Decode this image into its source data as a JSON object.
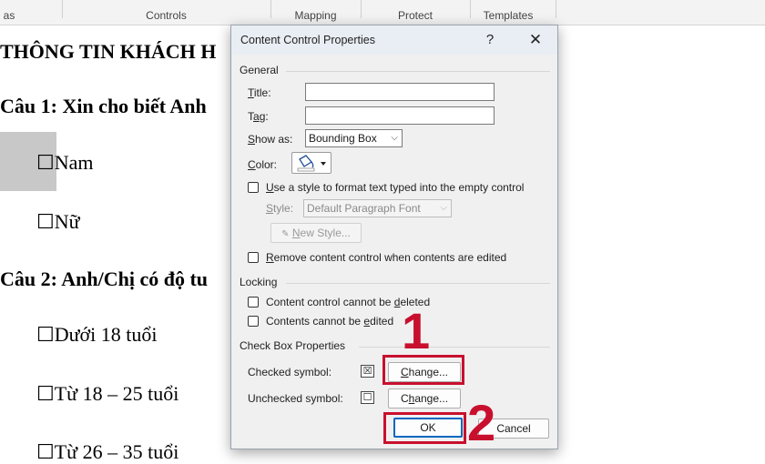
{
  "ribbon": {
    "groups": [
      "as",
      "Controls",
      "Mapping",
      "Protect",
      "Templates"
    ]
  },
  "document": {
    "heading": "THÔNG TIN KHÁCH H",
    "q1": "Câu 1: Xin cho biết Anh",
    "opt_nam": "☐Nam",
    "opt_nu": "☐Nữ",
    "q2": "Câu 2: Anh/Chị có độ tu",
    "opt_a": "☐Dưới 18 tuổi",
    "opt_b": "☐Từ 18 – 25 tuổi",
    "opt_c": "☐Từ 26 – 35 tuổi"
  },
  "dialog": {
    "title": "Content Control Properties",
    "help": "?",
    "close": "✕",
    "general": {
      "section": "General",
      "title_label": "Title:",
      "title_value": "",
      "tag_label": "Tag:",
      "tag_value": "",
      "show_as_label": "Show as:",
      "show_as_value": "Bounding Box",
      "color_label": "Color:",
      "use_style_label": "Use a style to format text typed into the empty control",
      "style_label": "Style:",
      "style_value": "Default Paragraph Font",
      "new_style_label": "New Style...",
      "remove_label": "Remove content control when contents are edited"
    },
    "locking": {
      "section": "Locking",
      "cannot_delete": "Content control cannot be deleted",
      "cannot_edit": "Contents cannot be edited"
    },
    "checkbox_props": {
      "section": "Check Box Properties",
      "checked_label": "Checked symbol:",
      "checked_symbol": "☒",
      "unchecked_label": "Unchecked symbol:",
      "unchecked_symbol": "☐",
      "change_label": "Change..."
    },
    "ok_label": "OK",
    "cancel_label": "Cancel"
  },
  "annotations": {
    "step1": "1",
    "step2": "2",
    "highlight_color": "#c8102e"
  }
}
